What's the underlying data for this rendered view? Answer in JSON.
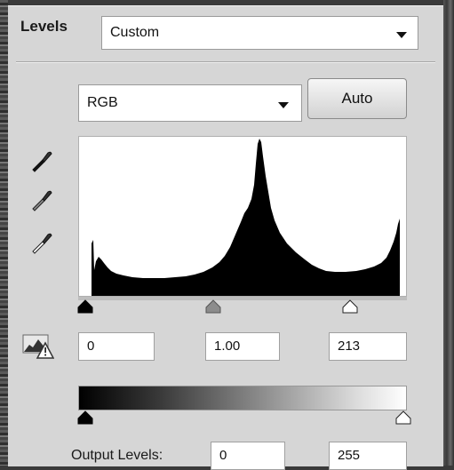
{
  "panel": {
    "title": "Levels",
    "preset_value": "Custom",
    "channel_value": "RGB",
    "auto_label": "Auto"
  },
  "input_levels": {
    "shadow": "0",
    "midtone": "1.00",
    "highlight": "213"
  },
  "output_levels": {
    "label": "Output Levels:",
    "low": "0",
    "high": "255"
  },
  "colors": {
    "panel_bg": "#d6d6d6",
    "histogram_fill": "#000000",
    "midtone_handle": "#8c8c8c"
  },
  "icons": [
    "black-eyedropper-icon",
    "gray-eyedropper-icon",
    "white-eyedropper-icon",
    "clipping-warning-icon",
    "chevron-down-icon"
  ]
}
